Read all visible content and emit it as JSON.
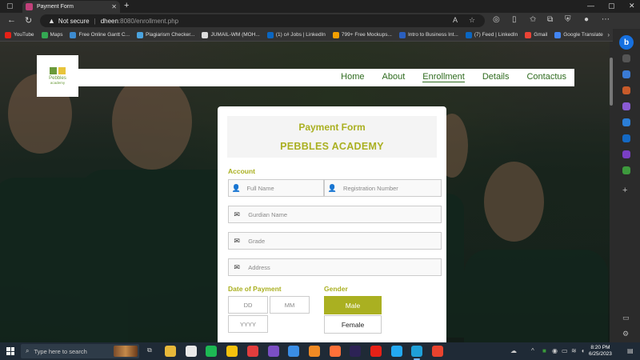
{
  "browser": {
    "tab_title": "Payment Form",
    "url_security": "Not secure",
    "url_host": "dheen",
    "url_path": ":8080/enrollment.php",
    "bookmarks": [
      {
        "label": "YouTube",
        "color": "#e62117"
      },
      {
        "label": "Maps",
        "color": "#34a853"
      },
      {
        "label": "Free Online Gantt C...",
        "color": "#3d8bd0"
      },
      {
        "label": "Plagiarism Checker...",
        "color": "#4aa3df"
      },
      {
        "label": "JUMAIL-WM (MOH...",
        "color": "#dddddd"
      },
      {
        "label": "(1) c# Jobs | LinkedIn",
        "color": "#0a66c2"
      },
      {
        "label": "799+ Free Mockups...",
        "color": "#f4a000"
      },
      {
        "label": "Intro to Business Int...",
        "color": "#2a5fbf"
      },
      {
        "label": "(7) Feed | LinkedIn",
        "color": "#0a66c2"
      },
      {
        "label": "Gmail",
        "color": "#ea4335"
      },
      {
        "label": "Google Translate",
        "color": "#4285f4"
      }
    ]
  },
  "site": {
    "logo_title": "Pebbles",
    "logo_sub": "academy",
    "nav": [
      "Home",
      "About",
      "Enrollment",
      "Details",
      "Contactus"
    ],
    "active_nav": "Enrollment"
  },
  "form": {
    "title": "Payment Form",
    "school": "PEBBLES ACADEMY",
    "account_heading": "Account",
    "full_name_placeholder": "Full Name",
    "registration_placeholder": "Registration Number",
    "guardian_placeholder": "Gurdian Name",
    "grade_placeholder": "Grade",
    "address_placeholder": "Address",
    "date_heading": "Date of Payment",
    "dd_placeholder": "DD",
    "mm_placeholder": "MM",
    "yyyy_placeholder": "YYYY",
    "gender_heading": "Gender",
    "gender_male": "Male",
    "gender_female": "Female",
    "gender_selected": "Male"
  },
  "taskbar": {
    "search_placeholder": "Type here to search",
    "time": "8:20 PM",
    "date": "6/25/2023",
    "apps": [
      {
        "name": "file-explorer",
        "color": "#e8b83a"
      },
      {
        "name": "media-player",
        "color": "#e9e9e9"
      },
      {
        "name": "spotify",
        "color": "#1db954"
      },
      {
        "name": "chrome",
        "color": "#f4c20d"
      },
      {
        "name": "cast",
        "color": "#e23d3d"
      },
      {
        "name": "visual-studio",
        "color": "#7b4fc4"
      },
      {
        "name": "app-cube",
        "color": "#3a8ee6"
      },
      {
        "name": "sublime",
        "color": "#f08a24"
      },
      {
        "name": "firefox",
        "color": "#ff7139"
      },
      {
        "name": "eclipse",
        "color": "#2c2255"
      },
      {
        "name": "youtube",
        "color": "#e62117"
      },
      {
        "name": "vscode",
        "color": "#23a9f2"
      },
      {
        "name": "edge",
        "color": "#1fa0d8"
      },
      {
        "name": "opera",
        "color": "#e8432e"
      }
    ]
  }
}
